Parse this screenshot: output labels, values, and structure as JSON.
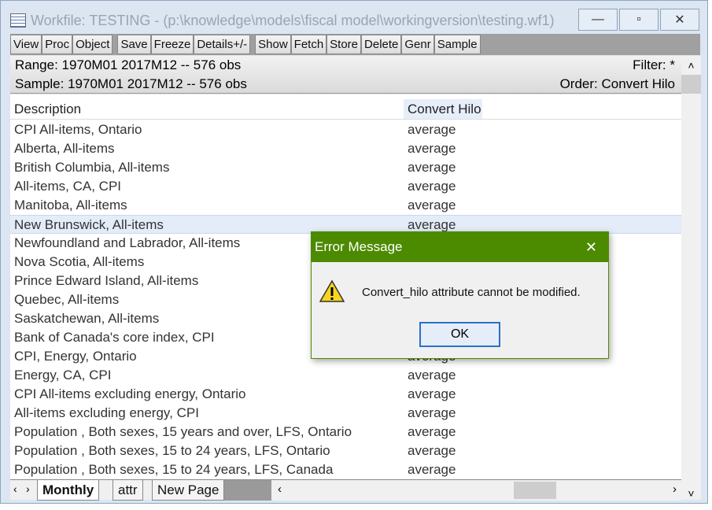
{
  "window": {
    "title": "Workfile: TESTING - (p:\\knowledge\\models\\fiscal model\\workingversion\\testing.wf1)",
    "minimize": "—",
    "maximize": "▫",
    "close": "✕"
  },
  "toolbar": [
    "View",
    "Proc",
    "Object",
    "|",
    "Save",
    "Freeze",
    "Details+/-",
    "|",
    "Show",
    "Fetch",
    "Store",
    "Delete",
    "Genr",
    "Sample"
  ],
  "info": {
    "range": "Range:  1970M01 2017M12   --   576 obs",
    "sample": "Sample: 1970M01 2017M12   --   576 obs",
    "filter": "Filter: *",
    "order": "Order: Convert Hilo"
  },
  "columns": {
    "description": "Description",
    "convert": "Convert Hilo"
  },
  "rows": [
    [
      "CPI All-items, Ontario",
      "average"
    ],
    [
      "Alberta, All-items",
      "average"
    ],
    [
      "British Columbia, All-items",
      "average"
    ],
    [
      "All-items, CA, CPI",
      "average"
    ],
    [
      "Manitoba, All-items",
      "average"
    ],
    [
      "New Brunswick, All-items",
      "average"
    ],
    [
      "Newfoundland and Labrador, All-items",
      ""
    ],
    [
      "Nova Scotia, All-items",
      ""
    ],
    [
      "Prince Edward Island, All-items",
      ""
    ],
    [
      "Quebec, All-items",
      ""
    ],
    [
      "Saskatchewan, All-items",
      ""
    ],
    [
      "Bank of Canada's core index, CPI",
      ""
    ],
    [
      "CPI, Energy, Ontario",
      "average"
    ],
    [
      "Energy, CA, CPI",
      "average"
    ],
    [
      "CPI All-items excluding energy, Ontario",
      "average"
    ],
    [
      "All-items excluding energy, CPI",
      "average"
    ],
    [
      "Population , Both sexes, 15 years and over, LFS, Ontario",
      "average"
    ],
    [
      "Population , Both sexes, 15 to 24 years, LFS, Ontario",
      "average"
    ],
    [
      "Population , Both sexes, 15 to 24 years, LFS, Canada",
      "average"
    ]
  ],
  "selected_row": 5,
  "tabs": [
    "Monthly",
    "attr",
    "New Page"
  ],
  "dialog": {
    "title": "Error Message",
    "message": "Convert_hilo attribute cannot be modified.",
    "ok": "OK",
    "close": "✕"
  },
  "colors": {
    "dialog_title": "#4c8a00",
    "selection": "#e3ecf8"
  }
}
